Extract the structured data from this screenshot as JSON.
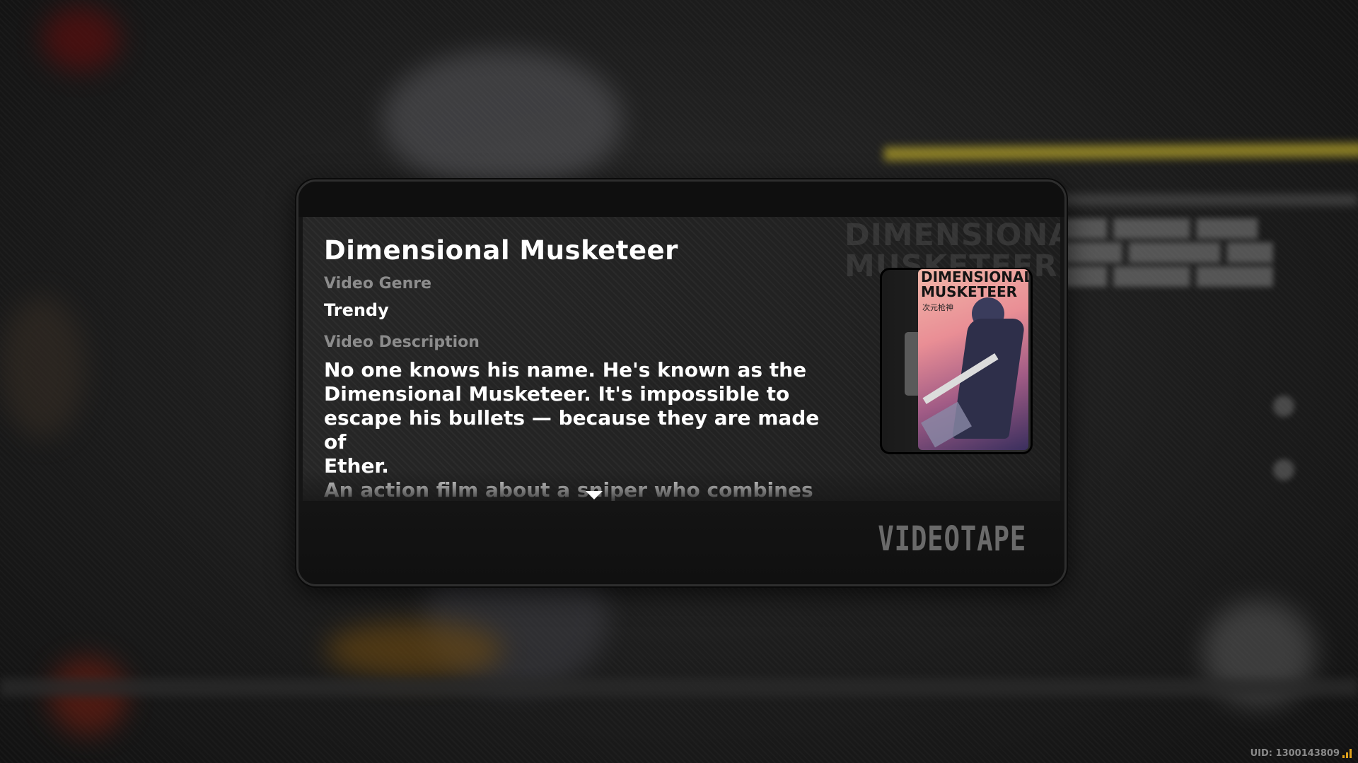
{
  "item": {
    "title": "Dimensional Musketeer",
    "genre_label": "Video Genre",
    "genre_value": "Trendy",
    "description_label": "Video Description",
    "description": "No one knows his name. He's known as the\nDimensional Musketeer. It's impossible to\nescape his bullets — because they are made of\nEther.\nAn action film about a sniper who combines\nEther technology and a sniper rifle to a"
  },
  "cover": {
    "background_title": "DIMENSIONAL\nMUSKETEER",
    "title": "DIMENSIONAL\nMUSKETEER",
    "subtitle": "次元枪神"
  },
  "footer": {
    "category": "VIDEOTAPE"
  },
  "hud": {
    "uid": "UID: 1300143809",
    "signal_icon": "signal-bars-icon"
  },
  "colors": {
    "accent": "#e0a21a",
    "panel": "#151515",
    "label": "#8c8c8c",
    "text": "#ffffff"
  }
}
